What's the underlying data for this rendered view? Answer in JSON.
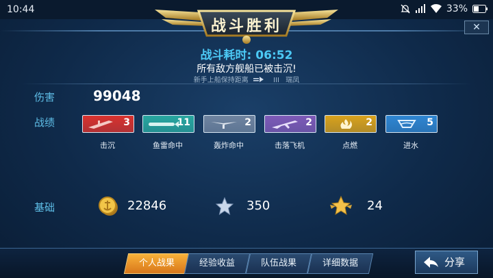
{
  "status_bar": {
    "time": "10:44",
    "battery": "33%",
    "icons": [
      "mute-icon",
      "signal-icon",
      "wifi-icon",
      "battery-icon"
    ]
  },
  "banner": {
    "title": "战斗胜利"
  },
  "battle": {
    "duration_label": "战斗耗时:",
    "duration_value": "06:52",
    "sunk_message": "所有敌方舰船已被击沉!",
    "hint_left": "新手上船保持距离",
    "hint_mid": "III",
    "hint_right": "瑞凤"
  },
  "stats": {
    "damage_label": "伤害",
    "damage_value": "99048",
    "record_label": "战绩",
    "records": [
      {
        "label": "击沉",
        "count": "3",
        "color": "#d9322e",
        "icon": "sinking-ship-icon"
      },
      {
        "label": "鱼雷命中",
        "count": "11",
        "color": "#28a6a0",
        "icon": "torpedo-icon"
      },
      {
        "label": "轰炸命中",
        "count": "2",
        "color": "#6f84a0",
        "icon": "bomb-icon"
      },
      {
        "label": "击落飞机",
        "count": "2",
        "color": "#7e5ab8",
        "icon": "plane-down-icon"
      },
      {
        "label": "点燃",
        "count": "2",
        "color": "#d9a21c",
        "icon": "fire-icon"
      },
      {
        "label": "进水",
        "count": "5",
        "color": "#2f86d2",
        "icon": "flood-icon"
      }
    ],
    "base_label": "基础",
    "base": [
      {
        "value": "22846",
        "icon": "gold-coin-icon"
      },
      {
        "value": "350",
        "icon": "silver-star-icon"
      },
      {
        "value": "24",
        "icon": "gold-star-icon"
      }
    ]
  },
  "tabs": [
    {
      "label": "个人战果",
      "active": true
    },
    {
      "label": "经验收益",
      "active": false
    },
    {
      "label": "队伍战果",
      "active": false
    },
    {
      "label": "详细数据",
      "active": false
    }
  ],
  "share_label": "分享",
  "close_label": "✕",
  "colors": {
    "accent": "#4cc9f5",
    "active_tab": "#f0a030",
    "gold": "#d9b34a"
  }
}
